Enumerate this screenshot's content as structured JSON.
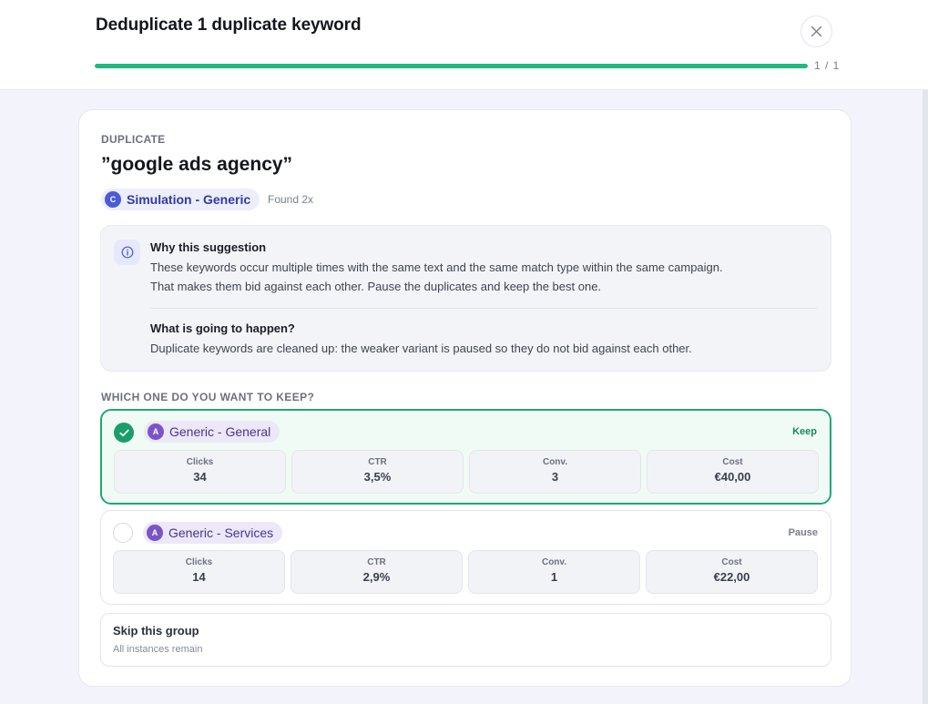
{
  "header": {
    "title": "Deduplicate 1 duplicate keyword",
    "progress_text": "1 / 1",
    "progress_value": 1.0,
    "close_icon": "close-icon"
  },
  "duplicate": {
    "eyebrow": "DUPLICATE",
    "keyword": "”google ads agency”",
    "campaign": {
      "avatar": "C",
      "name": "Simulation - Generic"
    },
    "found_text": "Found 2x"
  },
  "info": {
    "icon": "info-icon",
    "why_title": "Why this suggestion",
    "why_line1": "These keywords occur multiple times with the same text and the same match type within the same campaign.",
    "why_line2": "That makes them bid against each other. Pause the duplicates and keep the best one.",
    "what_title": "What is going to happen?",
    "what_text": "Duplicate keywords are cleaned up: the weaker variant is paused so they do not bid against each other."
  },
  "choose_label": "WHICH ONE DO YOU WANT TO KEEP?",
  "options": [
    {
      "avatar": "A",
      "name": "Generic - General",
      "action": "Keep",
      "selected": true,
      "metrics": [
        {
          "label": "Clicks",
          "value": "34"
        },
        {
          "label": "CTR",
          "value": "3,5%"
        },
        {
          "label": "Conv.",
          "value": "3"
        },
        {
          "label": "Cost",
          "value": "€40,00"
        }
      ]
    },
    {
      "avatar": "A",
      "name": "Generic - Services",
      "action": "Pause",
      "selected": false,
      "metrics": [
        {
          "label": "Clicks",
          "value": "14"
        },
        {
          "label": "CTR",
          "value": "2,9%"
        },
        {
          "label": "Conv.",
          "value": "1"
        },
        {
          "label": "Cost",
          "value": "€22,00"
        }
      ]
    }
  ],
  "skip": {
    "title": "Skip this group",
    "subtitle": "All instances remain"
  },
  "colors": {
    "accent_green": "#1fb87f",
    "keep_green": "#15895c",
    "campaign_blue": "#4a5bd4",
    "adgroup_purple": "#7a55c7"
  }
}
